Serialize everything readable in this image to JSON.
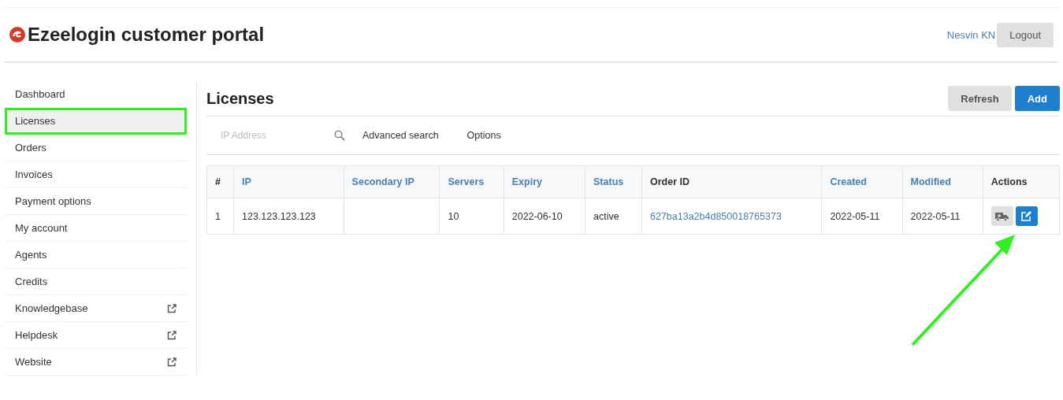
{
  "header": {
    "title": "Ezeelogin customer portal",
    "user": "Nesvin KN",
    "logout": "Logout"
  },
  "sidebar": {
    "items": [
      {
        "label": "Dashboard",
        "selected": false,
        "external": false,
        "highlighted": false
      },
      {
        "label": "Licenses",
        "selected": true,
        "external": false,
        "highlighted": true
      },
      {
        "label": "Orders",
        "selected": false,
        "external": false,
        "highlighted": false
      },
      {
        "label": "Invoices",
        "selected": false,
        "external": false,
        "highlighted": false
      },
      {
        "label": "Payment options",
        "selected": false,
        "external": false,
        "highlighted": false
      },
      {
        "label": "My account",
        "selected": false,
        "external": false,
        "highlighted": false
      },
      {
        "label": "Agents",
        "selected": false,
        "external": false,
        "highlighted": false
      },
      {
        "label": "Credits",
        "selected": false,
        "external": false,
        "highlighted": false
      },
      {
        "label": "Knowledgebase",
        "selected": false,
        "external": true,
        "highlighted": false
      },
      {
        "label": "Helpdesk",
        "selected": false,
        "external": true,
        "highlighted": false
      },
      {
        "label": "Website",
        "selected": false,
        "external": true,
        "highlighted": false
      }
    ]
  },
  "page": {
    "title": "Licenses",
    "buttons": [
      {
        "label": "Refresh",
        "kind": "default"
      },
      {
        "label": "Add",
        "kind": "primary"
      }
    ]
  },
  "search": {
    "placeholder": "IP Address",
    "links": [
      "Advanced search",
      "Options"
    ]
  },
  "table": {
    "columns": [
      {
        "label": "#",
        "sortable": false
      },
      {
        "label": "IP",
        "sortable": true
      },
      {
        "label": "Secondary IP",
        "sortable": true
      },
      {
        "label": "Servers",
        "sortable": true
      },
      {
        "label": "Expiry",
        "sortable": true
      },
      {
        "label": "Status",
        "sortable": true
      },
      {
        "label": "Order ID",
        "sortable": false
      },
      {
        "label": "Created",
        "sortable": true
      },
      {
        "label": "Modified",
        "sortable": true
      },
      {
        "label": "Actions",
        "sortable": false
      }
    ],
    "rows": [
      {
        "cells": [
          {
            "text": "1",
            "kind": "text"
          },
          {
            "text": "123.123.123.123",
            "kind": "text"
          },
          {
            "text": "",
            "kind": "text"
          },
          {
            "text": "10",
            "kind": "text"
          },
          {
            "text": "2022-06-10",
            "kind": "text"
          },
          {
            "text": "active",
            "kind": "text"
          },
          {
            "text": "627ba13a2b4d850018765373",
            "kind": "link"
          },
          {
            "text": "2022-05-11",
            "kind": "text"
          },
          {
            "text": "2022-05-11",
            "kind": "text"
          },
          {
            "kind": "actions"
          }
        ]
      }
    ]
  },
  "annotation": {
    "kind": "arrow"
  }
}
